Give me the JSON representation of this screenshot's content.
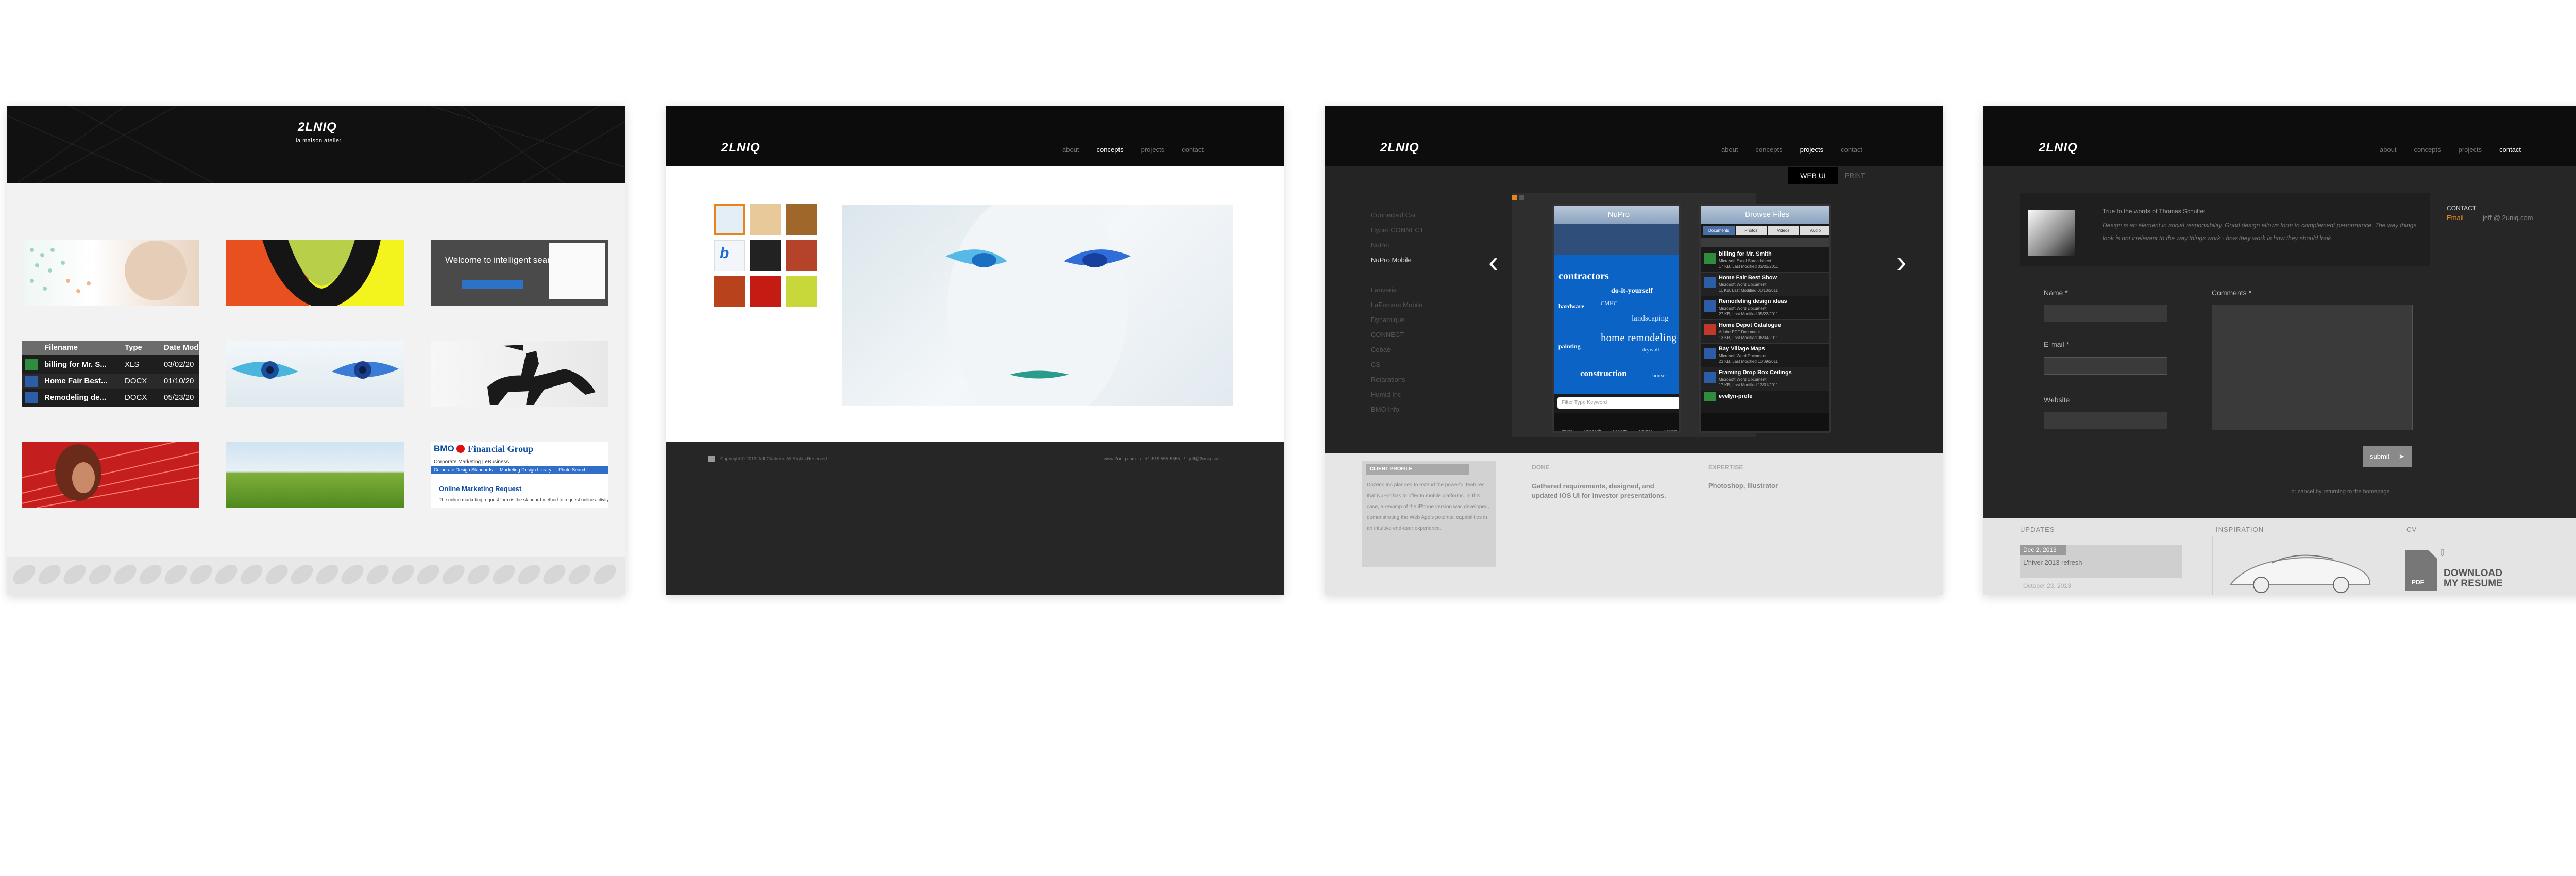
{
  "colors": {
    "dark": "#111111",
    "accent_orange": "#e8851a",
    "light": "#f2f2f2"
  },
  "panel1": {
    "logo": "2LNIQ",
    "tagline": "la maison atelier",
    "table": {
      "headers": [
        "Filename",
        "Type",
        "Date Mod"
      ],
      "rows": [
        {
          "name": "billing for Mr. S...",
          "type": "XLS",
          "date": "03/02/20"
        },
        {
          "name": "Home Fair Best...",
          "type": "DOCX",
          "date": "01/10/20"
        },
        {
          "name": "Remodeling de...",
          "type": "DOCX",
          "date": "05/23/20"
        }
      ]
    },
    "search_banner": "Welcome to intelligent search.",
    "bmo": {
      "brand": "BMO",
      "group": "Financial Group",
      "subtitle": "Corporate Marketing | eBusiness",
      "links": [
        "Corporate Design Standards",
        "Marketing Design Library",
        "Photo Search"
      ],
      "title": "Online Marketing Request",
      "body": "The online marketing request form is the standard method to request online activity"
    }
  },
  "panel2": {
    "logo": "2LNIQ",
    "nav": [
      "about",
      "concepts",
      "projects",
      "contact"
    ],
    "active_nav": "concepts",
    "footer_left": "Copyright © 2013 Jeff Chabrier. All Rights Reserved.",
    "footer_right": "www.2uniq.com   /   +1 519 555 5555   /   jeff@2uniq.com"
  },
  "panel3": {
    "logo": "2LNIQ",
    "nav": [
      "about",
      "concepts",
      "projects",
      "contact"
    ],
    "active_nav": "projects",
    "tabs": [
      "WEB UI",
      "PRINT"
    ],
    "sidebar": [
      "Connected Car",
      "Hyper CONNECT",
      "NuPro",
      "NuPro Mobile",
      "",
      "Lanveria",
      "LaFemme Mobile",
      "Dynamique",
      "CONNECT",
      "Cobaé",
      "CS",
      "Retarations",
      "Humid Inc",
      "BMO Info"
    ],
    "active_sidebar": "NuPro Mobile",
    "phone1": {
      "title": "NuPro",
      "cloud": [
        "contractors",
        "do-it-yourself",
        "landscaping",
        "home remodeling",
        "construction",
        "hardware",
        "painting",
        "CMHC",
        "drywall",
        "house"
      ],
      "search_placeholder": "Filter Type Keyword",
      "bottom": [
        "Browse",
        "Home Fair",
        "Contacts",
        "Sources",
        "Settings"
      ]
    },
    "phone2": {
      "title": "Browse Files",
      "filters": [
        "Documents",
        "Photos",
        "Videos",
        "Audio"
      ],
      "files": [
        {
          "name": "billing for Mr. Smith",
          "meta": "Microsoft Excel Spreadsheet",
          "date": "17 KB, Last Modified 03/02/2011"
        },
        {
          "name": "Home Fair Best Show",
          "meta": "Microsoft Word Document",
          "date": "11 KB, Last Modified 01/10/2011"
        },
        {
          "name": "Remodeling design ideas",
          "meta": "Microsoft Word Document",
          "date": "27 KB, Last Modified 05/23/2011"
        },
        {
          "name": "Home Depot Catalogue",
          "meta": "Adobe PDF Document",
          "date": "13 KB, Last Modified 08/04/2011"
        },
        {
          "name": "Bay Village Maps",
          "meta": "Microsoft Word Document",
          "date": "23 KB, Last Modified 11/09/2011"
        },
        {
          "name": "Framing Drop Box Ceilings",
          "meta": "Microsoft Word Document",
          "date": "17 KB, Last Modified 12/01/2011"
        },
        {
          "name": "evelyn-profe",
          "meta": "",
          "date": ""
        }
      ]
    },
    "client_profile_label": "CLIENT PROFILE",
    "client_profile_text": "Dozens Inc planned to extend the powerful features that NuPro has to offer to mobile platforms. In this case, a revamp of the iPhone version was developed, demonstrating the Web App's potential capabilities in an intuitive end-user experience.",
    "done_label": "DONE",
    "done_text": "Gathered requirements, designed, and updated iOS UI for investor presentations.",
    "expertise_label": "EXPERTISE",
    "expertise_text": "Photoshop, Illustrator"
  },
  "panel4": {
    "logo": "2LNIQ",
    "nav": [
      "about",
      "concepts",
      "projects",
      "contact"
    ],
    "active_nav": "contact",
    "quote_title": "True to the words of Thomas Schulte:",
    "quote": "Design is an element in social responsibility. Good design allows form to complement performance. The way things look is not irrelevant to the way things work - how they work is how they should look.",
    "contact_label": "CONTACT",
    "email_label": "Email",
    "email_value": "jeff @ 2uniq.com",
    "name_label": "Name *",
    "email_field_label": "E-mail *",
    "website_label": "Website",
    "comments_label": "Comments *",
    "submit_label": "submit",
    "return_text": "... or cancel by returning to the homepage.",
    "updates_label": "UPDATES",
    "update_date": "Dec 2, 2013",
    "update_text": "L'hiver 2013 refresh",
    "update_date2": "October 23, 2013",
    "inspiration_label": "INSPIRATION",
    "cv_label": "CV",
    "pdf_label": "PDF",
    "download_line1": "DOWNLOAD",
    "download_line2": "MY RESUME"
  }
}
